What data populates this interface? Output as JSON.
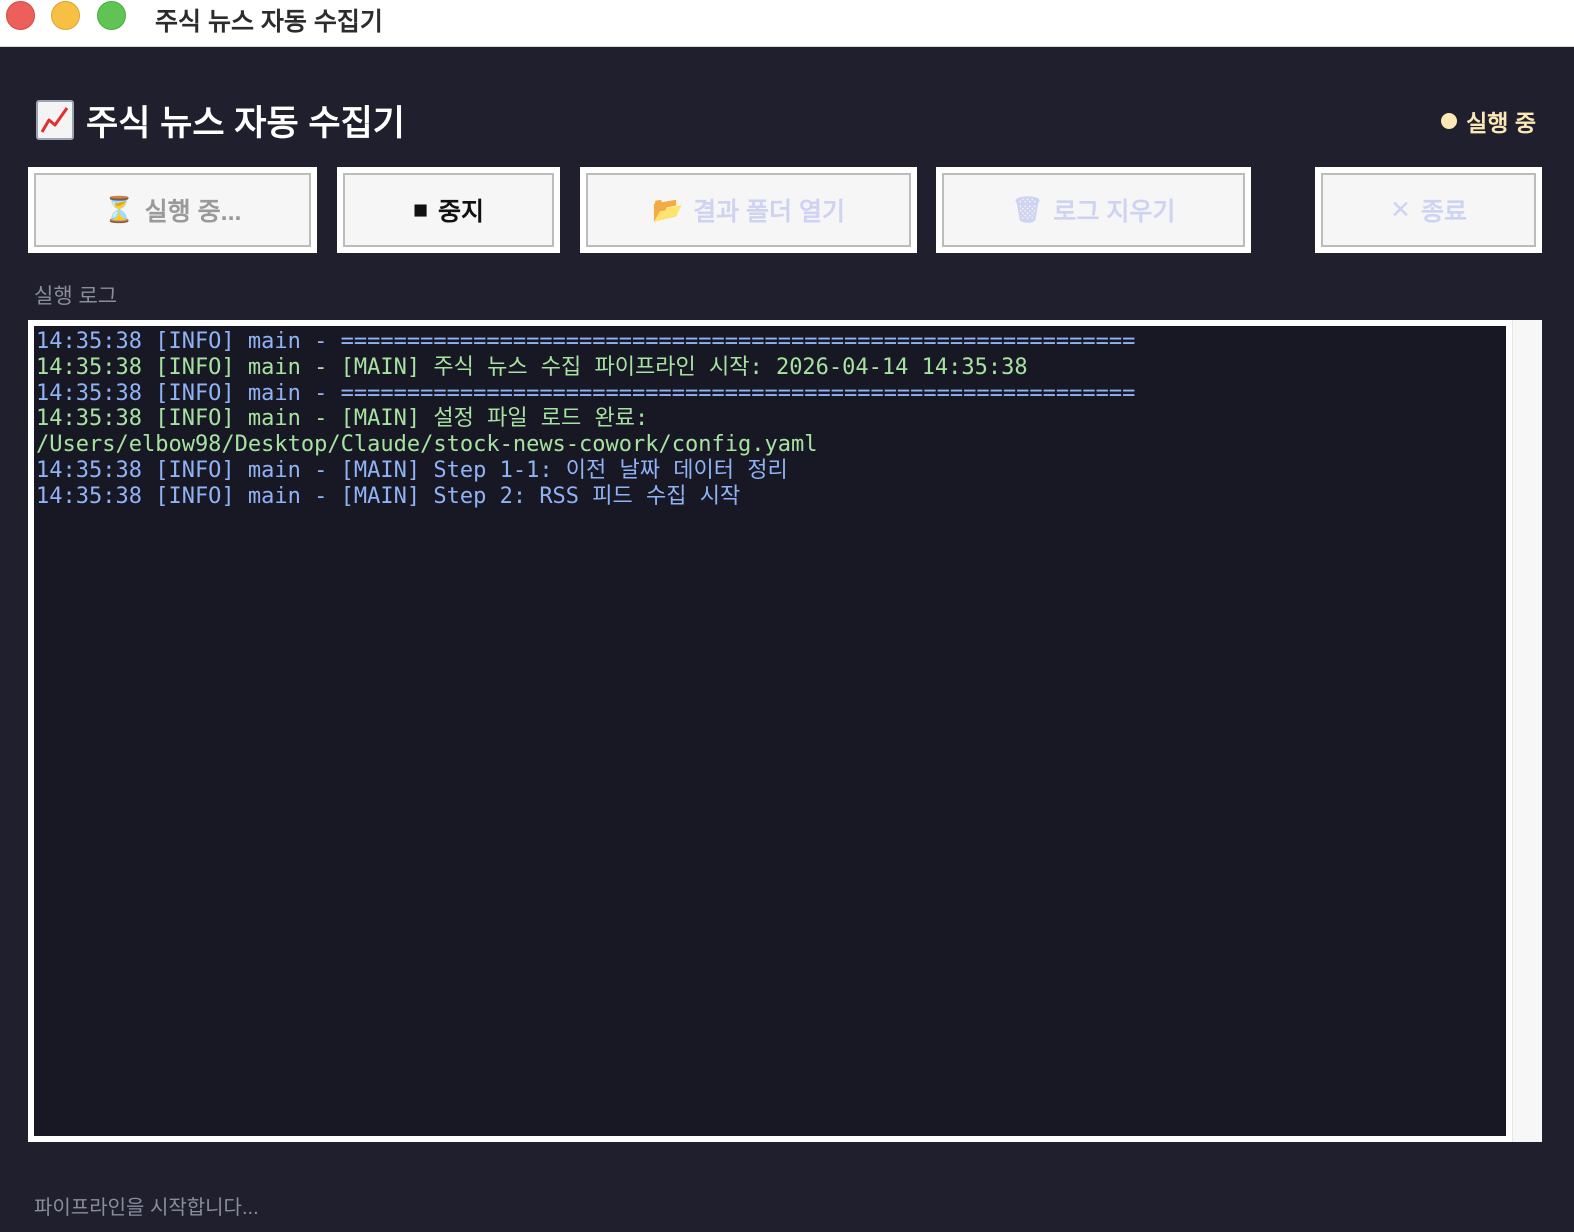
{
  "window": {
    "title": "주식 뉴스 자동 수집기"
  },
  "header": {
    "title": "주식 뉴스 자동 수집기",
    "title_icon": "chart-increasing-icon"
  },
  "status": {
    "label": "실행 중",
    "color": "#fce7b6"
  },
  "toolbar": {
    "run": {
      "icon": "⏳",
      "label": "실행 중..."
    },
    "stop": {
      "icon": "■",
      "label": "중지"
    },
    "open_folder": {
      "icon": "📂",
      "label": "결과 폴더 열기"
    },
    "clear_log": {
      "icon": "🗑",
      "label": "로그 지우기"
    },
    "quit": {
      "icon": "✕",
      "label": "종료"
    }
  },
  "log": {
    "label": "실행 로그",
    "lines": [
      "14:35:38 [INFO] main - ============================================================",
      "14:35:38 [INFO] main - [MAIN] 주식 뉴스 수집 파이프라인 시작: 2026-04-14 14:35:38",
      "14:35:38 [INFO] main - ============================================================",
      "14:35:38 [INFO] main - [MAIN] 설정 파일 로드 완료:",
      "/Users/elbow98/Desktop/Claude/stock-news-cowork/config.yaml",
      "14:35:38 [INFO] main - [MAIN] Step 1-1: 이전 날짜 데이터 정리",
      "14:35:38 [INFO] main - [MAIN] Step 2: RSS 피드 수집 시작"
    ]
  },
  "footer": {
    "status_text": "파이프라인을 시작합니다..."
  },
  "colors": {
    "background": "#1f1f2e",
    "log_background": "#181825",
    "log_info": "#8fb3f5",
    "log_main": "#a6e3a1"
  }
}
